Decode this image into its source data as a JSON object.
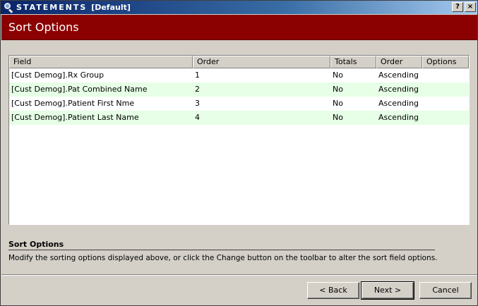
{
  "window": {
    "title_main": "STATEMENTS",
    "title_sub": "[Default]",
    "help_glyph": "?",
    "close_glyph": "×"
  },
  "header": {
    "title": "Sort Options"
  },
  "grid": {
    "columns": [
      "Field",
      "Order",
      "Totals",
      "Order",
      "Options"
    ],
    "rows": [
      {
        "field": "[Cust Demog].Rx Group",
        "order": "1",
        "totals": "No",
        "sort": "Ascending",
        "options": ""
      },
      {
        "field": "[Cust Demog].Pat Combined Name",
        "order": "2",
        "totals": "No",
        "sort": "Ascending",
        "options": ""
      },
      {
        "field": "[Cust Demog].Patient First Nme",
        "order": "3",
        "totals": "No",
        "sort": "Ascending",
        "options": ""
      },
      {
        "field": "[Cust Demog].Patient Last Name",
        "order": "4",
        "totals": "No",
        "sort": "Ascending",
        "options": ""
      }
    ]
  },
  "description": {
    "title": "Sort Options",
    "text": "Modify the sorting options displayed above, or click the Change button on the toolbar to alter the sort field options."
  },
  "buttons": {
    "back": "< Back",
    "next": "Next >",
    "cancel": "Cancel"
  },
  "colors": {
    "header_band": "#8b0000",
    "alt_row": "#e6ffe6",
    "titlebar_start": "#0a246a"
  }
}
